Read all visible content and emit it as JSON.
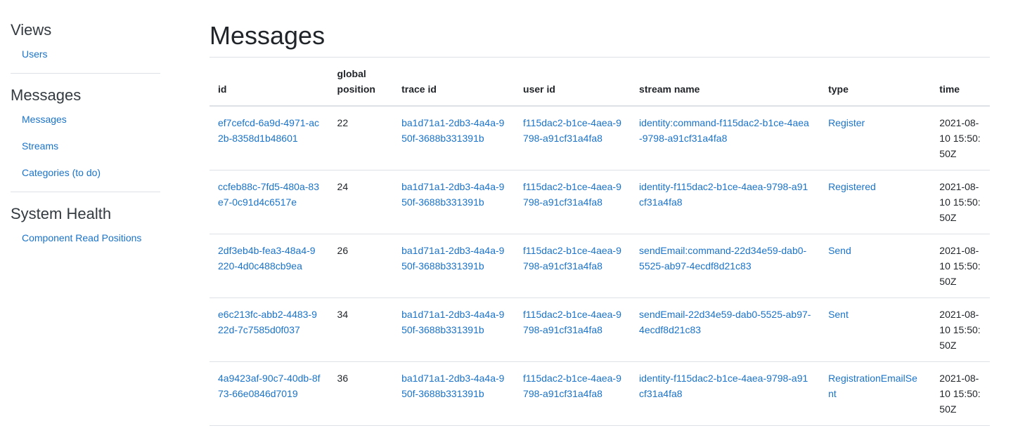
{
  "sidebar": {
    "sections": [
      {
        "title": "Views",
        "items": [
          {
            "label": "Users"
          }
        ]
      },
      {
        "title": "Messages",
        "items": [
          {
            "label": "Messages"
          },
          {
            "label": "Streams"
          },
          {
            "label": "Categories (to do)"
          }
        ]
      },
      {
        "title": "System Health",
        "items": [
          {
            "label": "Component Read Positions"
          }
        ]
      }
    ]
  },
  "main": {
    "title": "Messages",
    "table": {
      "headers": {
        "id": "id",
        "global_position": "global position",
        "trace_id": "trace id",
        "user_id": "user id",
        "stream_name": "stream name",
        "type": "type",
        "time": "time"
      },
      "rows": [
        {
          "id": "ef7cefcd-6a9d-4971-ac2b-8358d1b48601",
          "global_position": "22",
          "trace_id": "ba1d71a1-2db3-4a4a-950f-3688b331391b",
          "user_id": "f115dac2-b1ce-4aea-9798-a91cf31a4fa8",
          "stream_name": "identity:command-f115dac2-b1ce-4aea-9798-a91cf31a4fa8",
          "type": "Register",
          "time": "2021-08-10 15:50:50Z"
        },
        {
          "id": "ccfeb88c-7fd5-480a-83e7-0c91d4c6517e",
          "global_position": "24",
          "trace_id": "ba1d71a1-2db3-4a4a-950f-3688b331391b",
          "user_id": "f115dac2-b1ce-4aea-9798-a91cf31a4fa8",
          "stream_name": "identity-f115dac2-b1ce-4aea-9798-a91cf31a4fa8",
          "type": "Registered",
          "time": "2021-08-10 15:50:50Z"
        },
        {
          "id": "2df3eb4b-fea3-48a4-9220-4d0c488cb9ea",
          "global_position": "26",
          "trace_id": "ba1d71a1-2db3-4a4a-950f-3688b331391b",
          "user_id": "f115dac2-b1ce-4aea-9798-a91cf31a4fa8",
          "stream_name": "sendEmail:command-22d34e59-dab0-5525-ab97-4ecdf8d21c83",
          "type": "Send",
          "time": "2021-08-10 15:50:50Z"
        },
        {
          "id": "e6c213fc-abb2-4483-922d-7c7585d0f037",
          "global_position": "34",
          "trace_id": "ba1d71a1-2db3-4a4a-950f-3688b331391b",
          "user_id": "f115dac2-b1ce-4aea-9798-a91cf31a4fa8",
          "stream_name": "sendEmail-22d34e59-dab0-5525-ab97-4ecdf8d21c83",
          "type": "Sent",
          "time": "2021-08-10 15:50:50Z"
        },
        {
          "id": "4a9423af-90c7-40db-8f73-66e0846d7019",
          "global_position": "36",
          "trace_id": "ba1d71a1-2db3-4a4a-950f-3688b331391b",
          "user_id": "f115dac2-b1ce-4aea-9798-a91cf31a4fa8",
          "stream_name": "identity-f115dac2-b1ce-4aea-9798-a91cf31a4fa8",
          "type": "RegistrationEmailSent",
          "time": "2021-08-10 15:50:50Z"
        }
      ]
    }
  },
  "colors": {
    "link": "#1a73c9",
    "text": "#212529",
    "border": "#dee2e6"
  }
}
